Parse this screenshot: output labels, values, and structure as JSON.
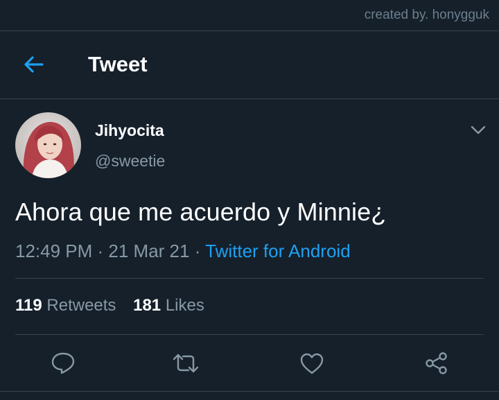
{
  "watermark": "created by. honygguk",
  "header": {
    "title": "Tweet",
    "back_icon": "arrow-left-icon"
  },
  "tweet": {
    "display_name": "Jihyocita",
    "handle": "@sweetie",
    "text": "Ahora que me acuerdo y Minnie¿",
    "time": "12:49 PM",
    "separator": " · ",
    "date": "21 Mar 21",
    "source": "Twitter for Android"
  },
  "stats": {
    "retweets_count": "119",
    "retweets_label": "Retweets",
    "likes_count": "181",
    "likes_label": "Likes"
  },
  "actions": [
    "reply-icon",
    "retweet-icon",
    "like-icon",
    "share-icon"
  ],
  "colors": {
    "background": "#15202b",
    "accent": "#1da1f2",
    "secondary_text": "#8899a6",
    "divider": "#38444d"
  }
}
